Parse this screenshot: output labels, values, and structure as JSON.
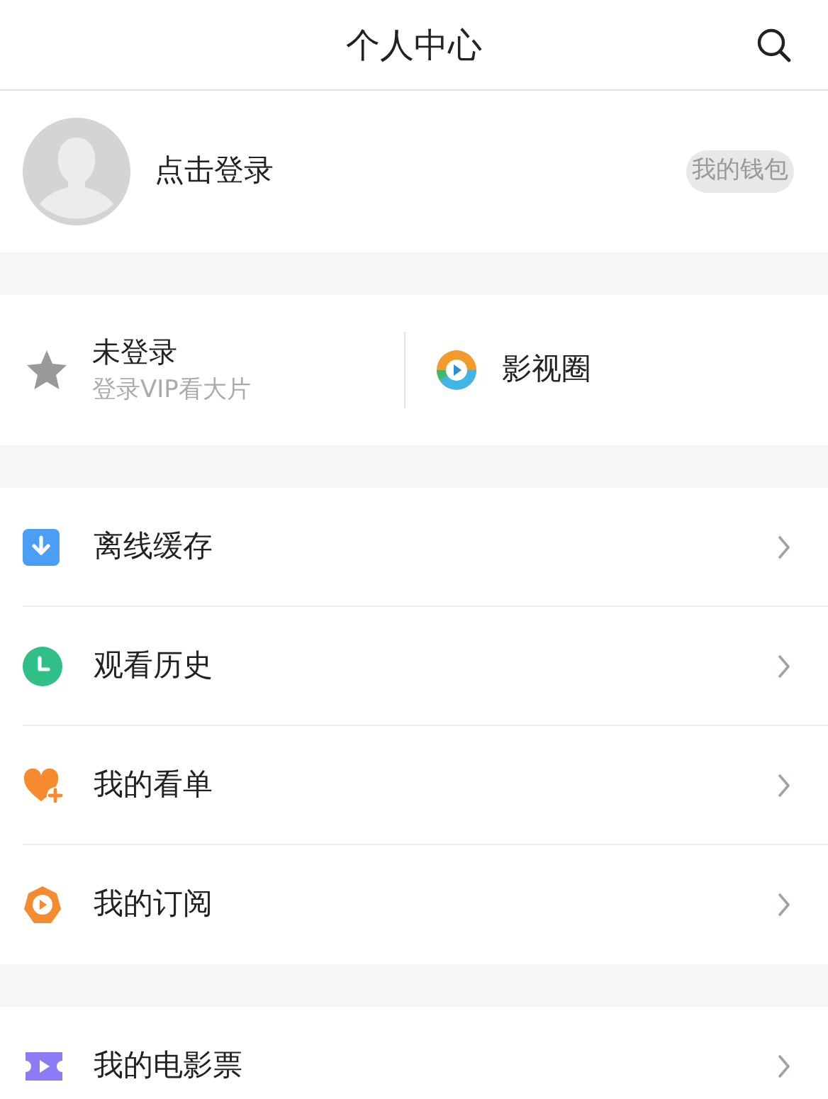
{
  "header": {
    "title": "个人中心"
  },
  "profile": {
    "login_text": "点击登录",
    "wallet_button": "我的钱包"
  },
  "vip": {
    "title": "未登录",
    "subtitle": "登录VIP看大片",
    "circle_label": "影视圈"
  },
  "menu_groups": [
    [
      {
        "kind": "download",
        "label": "离线缓存"
      },
      {
        "kind": "history",
        "label": "观看历史"
      },
      {
        "kind": "watchlist",
        "label": "我的看单"
      },
      {
        "kind": "subscribe",
        "label": "我的订阅"
      }
    ],
    [
      {
        "kind": "ticket",
        "label": "我的电影票"
      }
    ]
  ]
}
